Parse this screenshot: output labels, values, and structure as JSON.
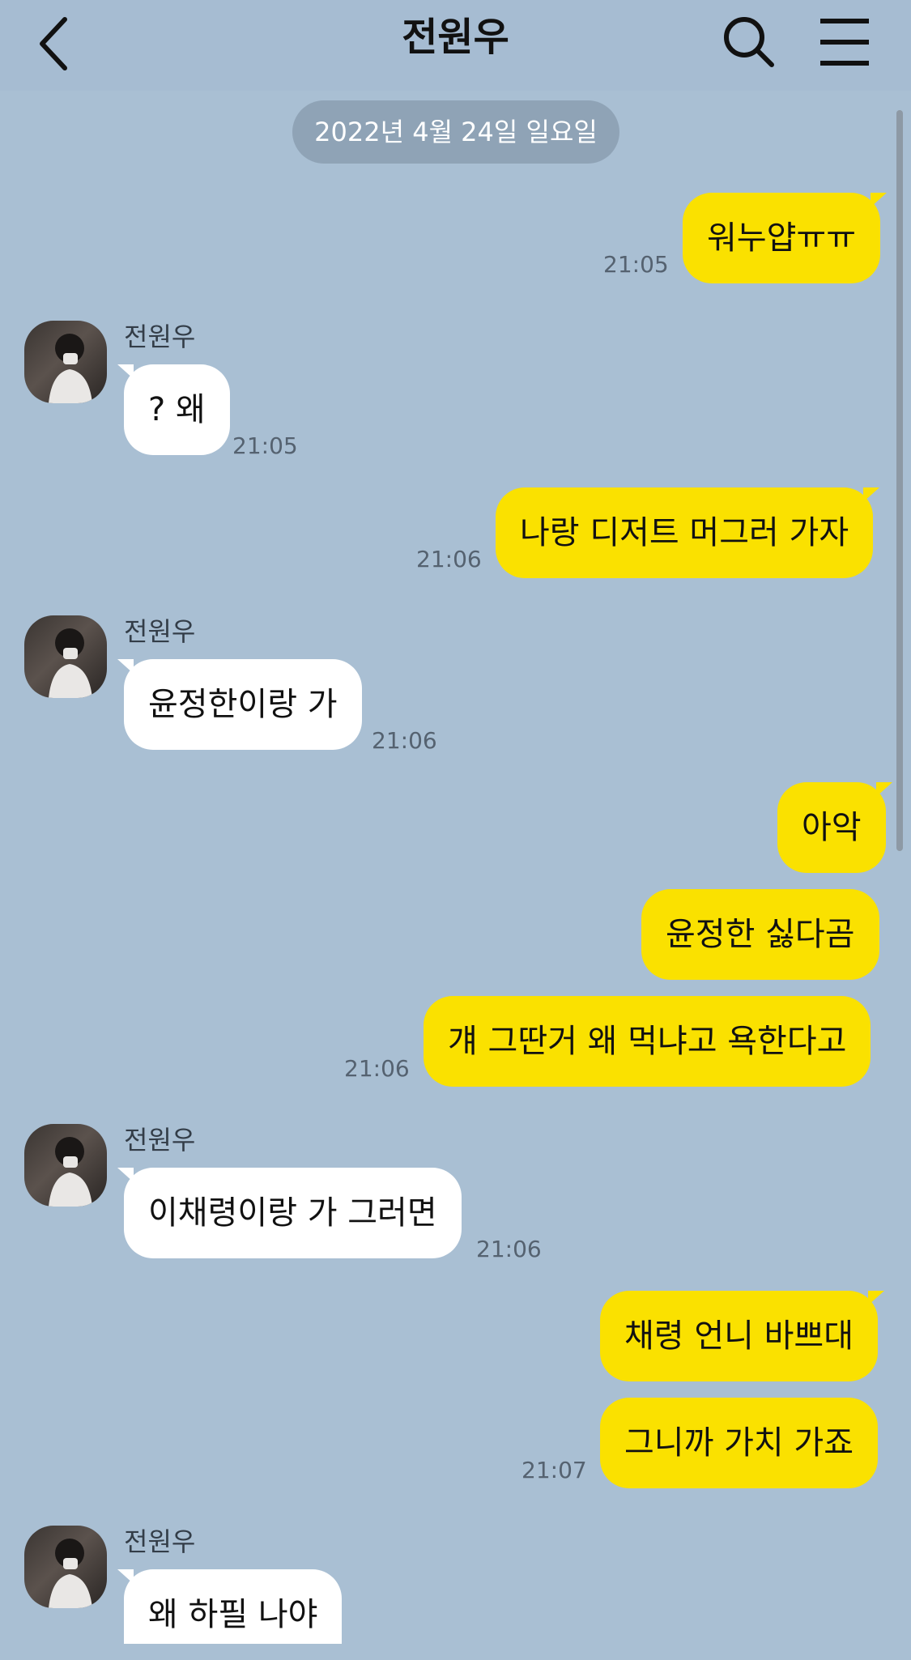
{
  "header": {
    "title": "전원우",
    "back_icon": "chevron-left-icon",
    "search_icon": "search-icon",
    "menu_icon": "menu-icon"
  },
  "date_divider": "2022년 4월 24일 일요일",
  "colors": {
    "background": "#a9bfd3",
    "my_bubble": "#fae100",
    "their_bubble": "#ffffff"
  },
  "messages": [
    {
      "from": "me",
      "text": "워누얍ㅠㅠ",
      "time": "21:05"
    },
    {
      "from": "them",
      "sender": "전원우",
      "text": "? 왜",
      "time": "21:05"
    },
    {
      "from": "me",
      "text": "나랑 디저트 머그러 가자",
      "time": "21:06"
    },
    {
      "from": "them",
      "sender": "전원우",
      "text": "윤정한이랑 가",
      "time": "21:06"
    },
    {
      "from": "me",
      "text": "아악",
      "time": ""
    },
    {
      "from": "me",
      "text": "윤정한 싫다곰",
      "time": ""
    },
    {
      "from": "me",
      "text": "걔 그딴거 왜 먹냐고 욕한다고",
      "time": "21:06"
    },
    {
      "from": "them",
      "sender": "전원우",
      "text": "이채령이랑 가 그러면",
      "time": "21:06"
    },
    {
      "from": "me",
      "text": "채령 언니 바쁘대",
      "time": ""
    },
    {
      "from": "me",
      "text": "그니까 가치 가죠",
      "time": "21:07"
    },
    {
      "from": "them",
      "sender": "전원우",
      "text": "왜 하필 나야",
      "time": ""
    }
  ]
}
